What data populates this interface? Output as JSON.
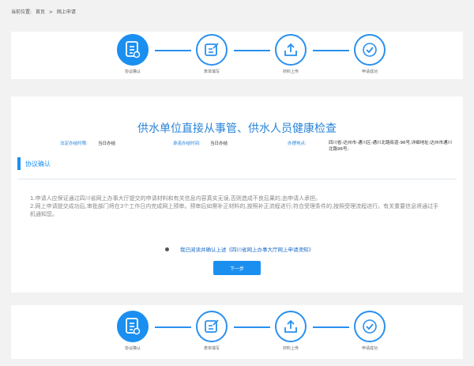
{
  "breadcrumb": {
    "prefix": "当前位置:",
    "home": "首页",
    "sep": ">",
    "current": "网上申请"
  },
  "steps": [
    {
      "label": "协议确认",
      "icon": "document-list-icon",
      "active": true
    },
    {
      "label": "表单填写",
      "icon": "form-edit-icon",
      "active": false
    },
    {
      "label": "材料上传",
      "icon": "upload-icon",
      "active": false
    },
    {
      "label": "申请成功",
      "icon": "check-circle-icon",
      "active": false
    }
  ],
  "main": {
    "title": "供水单位直接从事管、供水人员健康检查",
    "info": {
      "legal_time_label": "法定办结时限:",
      "legal_time_value": "当日办结",
      "promise_time_label": "承诺办结时间:",
      "promise_time_value": "当日办结",
      "address_label": "办理地点:",
      "address_value": "四川省-达州市-通川区-通川北路街道-96号,详细地址:达州市通川北路96号;"
    },
    "section_title": "协议确认",
    "terms": [
      "1.申请人应保证通过四川省网上办事大厅提交的申请材料和有关信息内容真实无误,否则造成不良后果的,由申请人承担。",
      "2.网上申请提交成功后,审批部门将在3个工作日内完成网上预审。预审后如需补正材料的,按照补正流程进行;符合受理条件的,按照受理流程进行。有关重要信息将通过手机通知您。"
    ],
    "agree_text": "我已阅读并确认上述《四川省网上办事大厅网上申请须知》",
    "next_button": "下一步"
  },
  "colors": {
    "accent": "#1a8ff0",
    "title": "#2a84d8"
  }
}
